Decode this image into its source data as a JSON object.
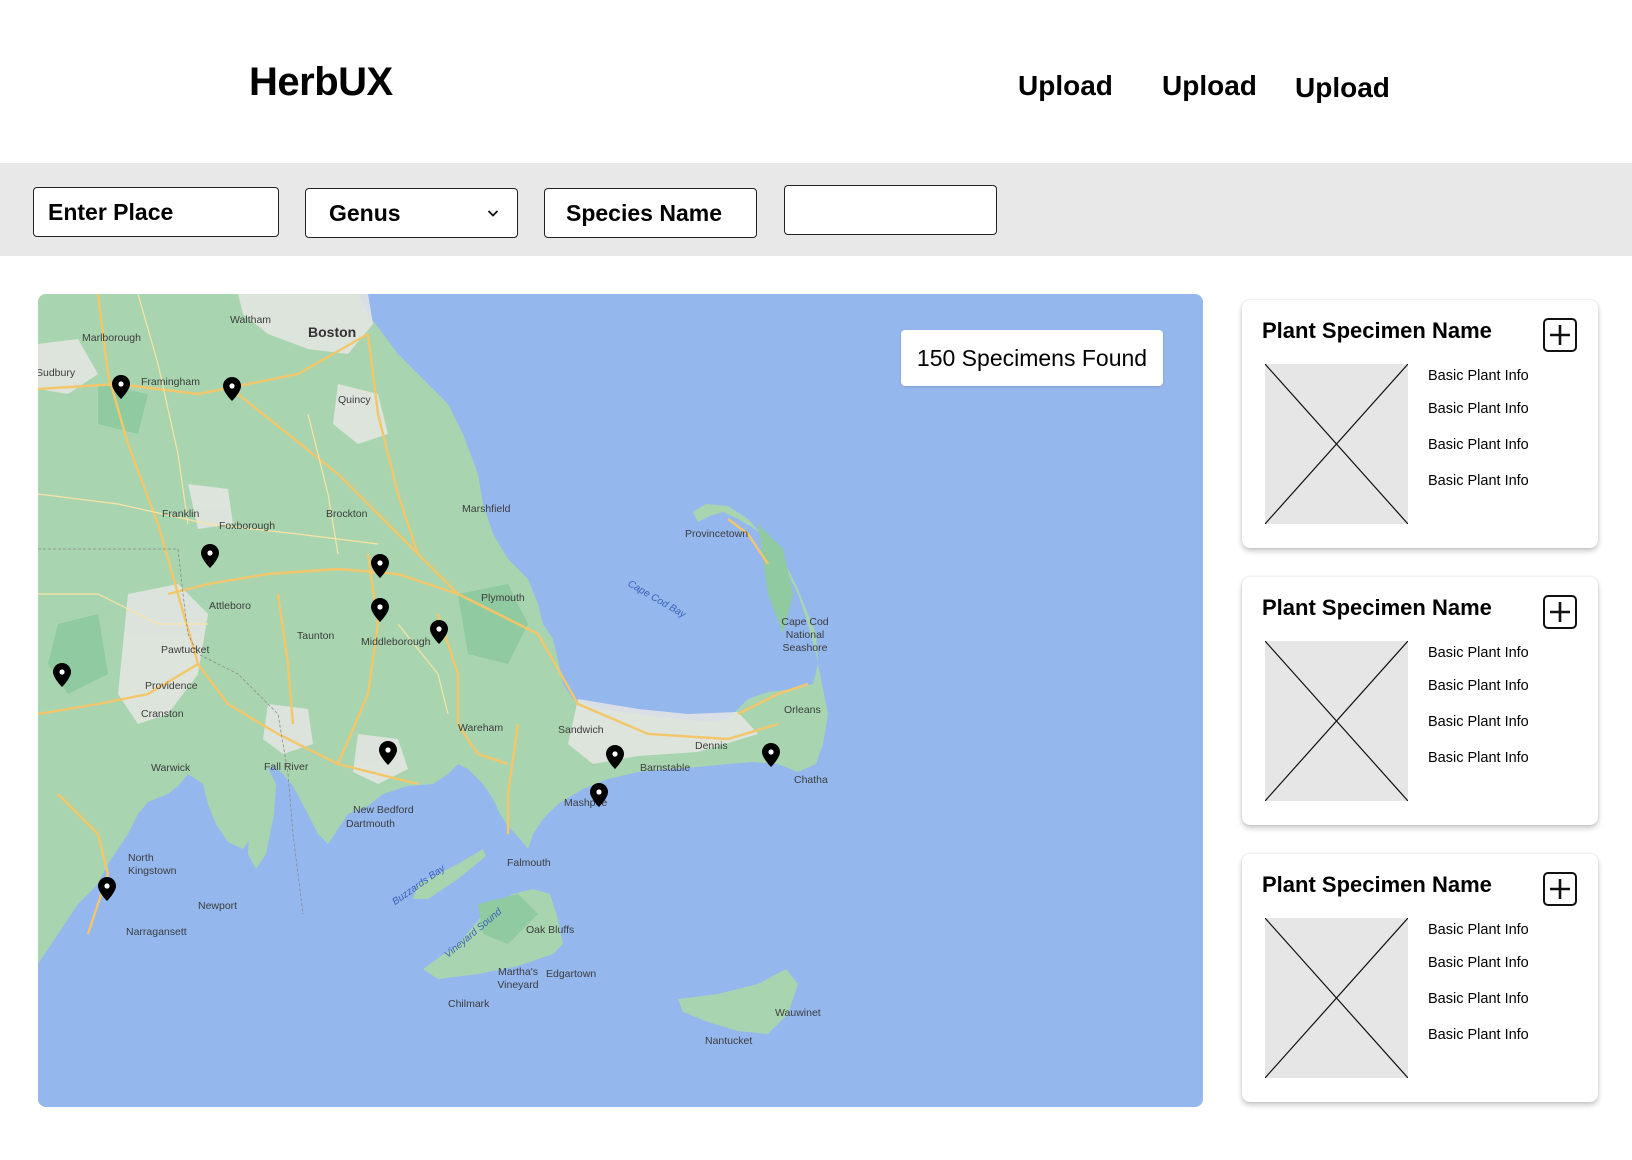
{
  "header": {
    "logo": "HerbUX",
    "nav": [
      "Upload",
      "Upload",
      "Upload"
    ]
  },
  "filters": {
    "place": {
      "value": "Enter Place"
    },
    "genus": {
      "value": "Genus",
      "icon": "chevron-down-icon"
    },
    "species": {
      "value": "Species Name"
    },
    "extra": {
      "value": ""
    }
  },
  "map": {
    "results_label": "150 Specimens Found",
    "land_color": "#a8d5b0",
    "water_color": "#94b7ee",
    "labels": {
      "boston": "Boston",
      "waltham": "Waltham",
      "marlborough": "Marlborough",
      "framingham": "Framingham",
      "quincy": "Quincy",
      "franklin": "Franklin",
      "foxborough": "Foxborough",
      "brockton": "Brockton",
      "marshfield": "Marshfield",
      "attleboro": "Attleboro",
      "taunton": "Taunton",
      "pawtucket": "Pawtucket",
      "providence": "Providence",
      "cranston": "Cranston",
      "middleborough": "Middleborough",
      "plymouth": "Plymouth",
      "warwick": "Warwick",
      "fall_river": "Fall River",
      "wareham": "Wareham",
      "sandwich": "Sandwich",
      "new_bedford": "New Bedford",
      "dartmouth": "Dartmouth",
      "barnstable": "Barnstable",
      "dennis": "Dennis",
      "mashpee": "Mashpee",
      "falmouth": "Falmouth",
      "provincetown": "Provincetown",
      "orleans": "Orleans",
      "chatham": "Chatha",
      "cape_cod_ns": "Cape Cod National Seashore",
      "north_kingstown": "North Kingstown",
      "newport": "Newport",
      "narragansett": "Narragansett",
      "oak_bluffs": "Oak Bluffs",
      "marthas_vineyard": "Martha's Vineyard",
      "edgartown": "Edgartown",
      "chilmark": "Chilmark",
      "nantucket": "Nantucket",
      "wauwinet": "Wauwinet",
      "cape_cod_bay": "Cape Cod Bay",
      "buzzards_bay": "Buzzards Bay",
      "vineyard_sound": "Vineyard Sound",
      "sudbury": "Sudbury"
    },
    "pins": [
      "specimen-1",
      "specimen-2",
      "specimen-3",
      "specimen-4",
      "specimen-5",
      "specimen-6",
      "specimen-7",
      "specimen-8",
      "specimen-9",
      "specimen-10",
      "specimen-11",
      "specimen-12"
    ]
  },
  "cards": [
    {
      "title": "Plant Specimen Name",
      "info": [
        "Basic Plant Info",
        "Basic Plant Info",
        "Basic Plant Info",
        "Basic Plant Info"
      ]
    },
    {
      "title": "Plant Specimen Name",
      "info": [
        "Basic Plant Info",
        "Basic Plant Info",
        "Basic Plant Info",
        "Basic Plant Info"
      ]
    },
    {
      "title": "Plant Specimen Name",
      "info": [
        "Basic Plant Info",
        "Basic Plant Info",
        "Basic Plant Info",
        "Basic Plant Info"
      ]
    }
  ]
}
